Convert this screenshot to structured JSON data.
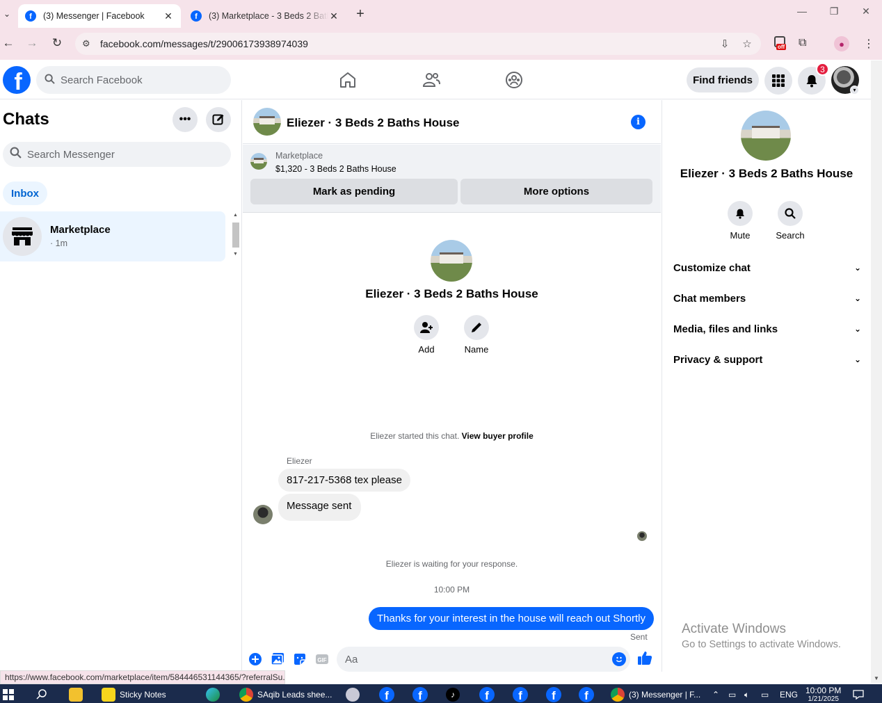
{
  "browser": {
    "tabs": [
      {
        "title": "(3) Messenger | Facebook",
        "active": true
      },
      {
        "title": "(3) Marketplace - 3 Beds 2 Baths House",
        "active": false
      }
    ],
    "url": "facebook.com/messages/t/29006173938974039",
    "extension_badge": "off",
    "status_url": "https://www.facebook.com/marketplace/item/584446531144365/?referralSu..."
  },
  "fbnav": {
    "search_placeholder": "Search Facebook",
    "find_friends": "Find friends",
    "notifications_count": "3"
  },
  "chats": {
    "title": "Chats",
    "search_placeholder": "Search Messenger",
    "filter": "Inbox",
    "items": [
      {
        "name": "Marketplace",
        "time": "· 1m"
      }
    ]
  },
  "conversation": {
    "title": "Eliezer · 3 Beds 2 Baths House",
    "banner": {
      "label": "Marketplace",
      "listing": "$1,320 - 3 Beds 2 Baths House",
      "mark_pending": "Mark as pending",
      "more_options": "More options"
    },
    "hero_actions": {
      "add": "Add",
      "name": "Name"
    },
    "started_text": "Eliezer started this chat.",
    "buyer_profile_link": "View buyer profile",
    "sender_name": "Eliezer",
    "incoming": [
      "817-217-5368 tex please",
      "Message sent"
    ],
    "waiting_text": "Eliezer is waiting for your response.",
    "timestamp": "10:00 PM",
    "outgoing": "Thanks for your interest in the house will reach out Shortly",
    "sent_label": "Sent",
    "input_placeholder": "Aa"
  },
  "info_panel": {
    "title": "Eliezer · 3 Beds 2 Baths House",
    "actions": {
      "mute": "Mute",
      "search": "Search"
    },
    "sections": [
      "Customize chat",
      "Chat members",
      "Media, files and links",
      "Privacy & support"
    ]
  },
  "watermark": {
    "line1": "Activate Windows",
    "line2": "Go to Settings to activate Windows."
  },
  "taskbar": {
    "sticky_notes": "Sticky Notes",
    "sheets": "SAqib Leads shee...",
    "messenger": "(3) Messenger | F...",
    "lang": "ENG",
    "time": "10:00 PM",
    "date": "1/21/2025"
  },
  "colors": {
    "fb_blue": "#0866ff",
    "chrome_pink": "#f6e3ea",
    "taskbar": "#1b2b4c"
  }
}
